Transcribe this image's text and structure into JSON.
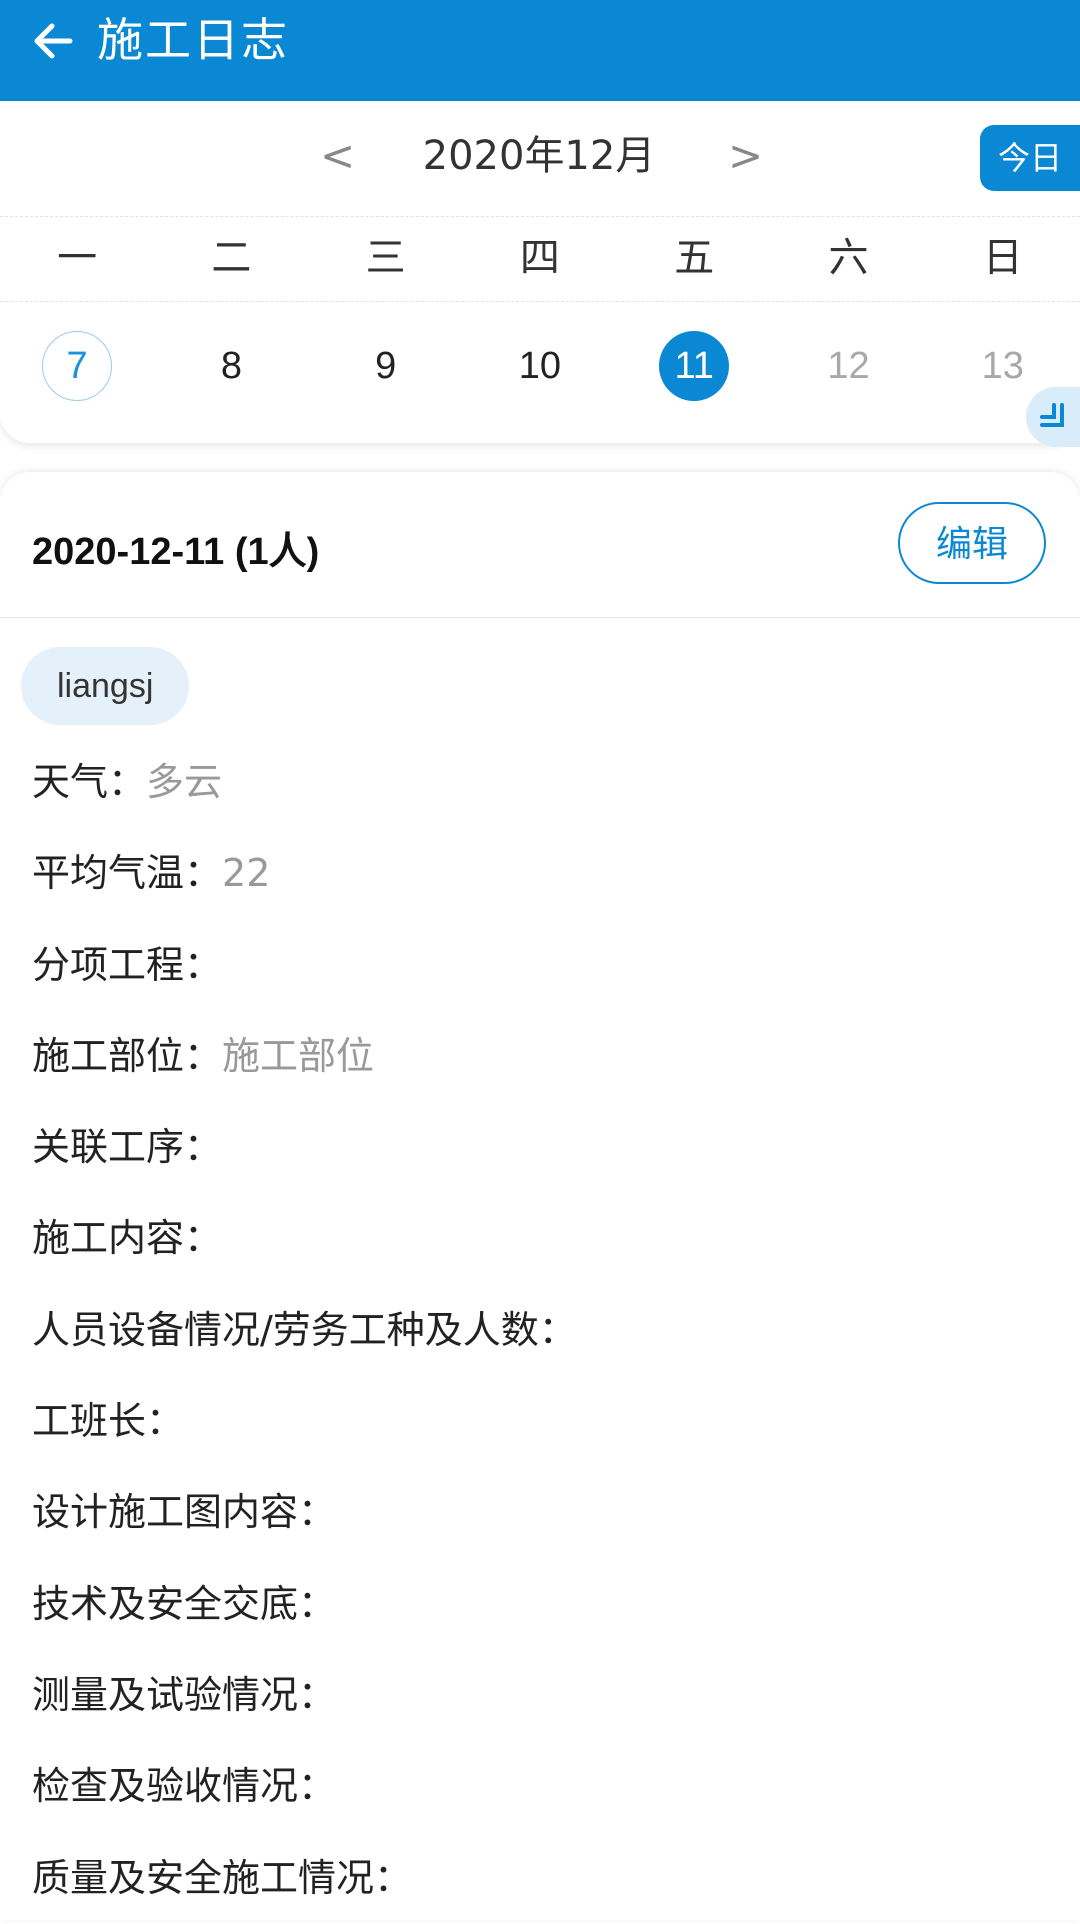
{
  "header": {
    "title": "施工日志",
    "back_icon": "arrow-left-icon",
    "background": "#0b88d4"
  },
  "calendar": {
    "prev_label": "<",
    "next_label": ">",
    "month_label": "2020年12月",
    "today_label": "今日",
    "weekdays": [
      "一",
      "二",
      "三",
      "四",
      "五",
      "六",
      "日"
    ],
    "dates": [
      "7",
      "8",
      "9",
      "10",
      "11",
      "12",
      "13"
    ],
    "today_index": 0,
    "selected_index": 4,
    "expand_icon": "expand-corner-icon"
  },
  "detail": {
    "date_title": "2020-12-11 (1人)",
    "edit_label": "编辑",
    "user": "liangsj",
    "fields": [
      {
        "label": "天气：",
        "value": "多云"
      },
      {
        "label": "平均气温：",
        "value": "22"
      },
      {
        "label": "分项工程：",
        "value": ""
      },
      {
        "label": "施工部位：",
        "value": "施工部位"
      },
      {
        "label": "关联工序：",
        "value": ""
      },
      {
        "label": "施工内容：",
        "value": ""
      },
      {
        "label": "人员设备情况/劳务工种及人数：",
        "value": ""
      },
      {
        "label": "工班长：",
        "value": ""
      },
      {
        "label": "设计施工图内容：",
        "value": ""
      },
      {
        "label": "技术及安全交底：",
        "value": ""
      },
      {
        "label": "测量及试验情况：",
        "value": ""
      },
      {
        "label": "检查及验收情况：",
        "value": ""
      },
      {
        "label": "质量及安全施工情况：",
        "value": ""
      }
    ]
  },
  "colors": {
    "accent": "#0b88d4",
    "muted": "#999999",
    "chip_bg": "#e4f1fb"
  }
}
